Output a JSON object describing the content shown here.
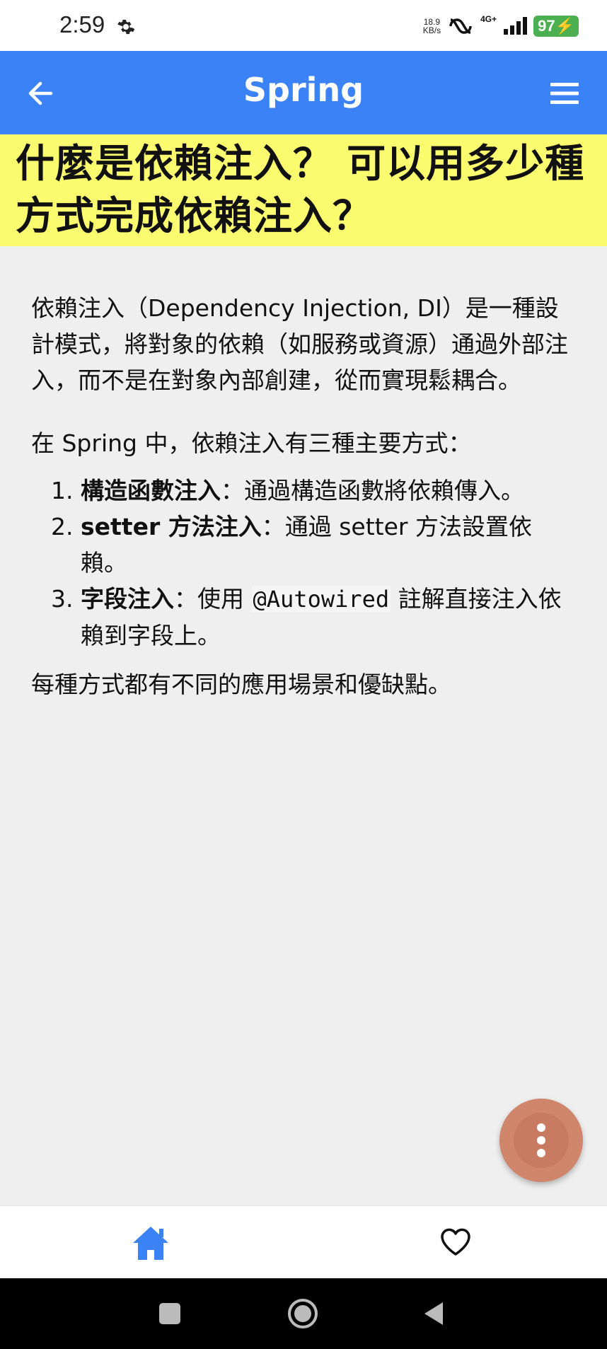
{
  "status_bar": {
    "time": "2:59",
    "net_speed_value": "18.9",
    "net_speed_unit": "KB/s",
    "network": "4G+",
    "battery": "97"
  },
  "app_bar": {
    "title": "Spring",
    "back_icon": "arrow-back-icon",
    "menu_icon": "hamburger-menu-icon",
    "color": "#3b82f6"
  },
  "question": {
    "title": "什麼是依賴注入？ 可以用多少種方式完成依賴注入？",
    "highlight_color": "#fbfb6f"
  },
  "answer": {
    "intro": "依賴注入（Dependency Injection, DI）是一種設計模式，將對象的依賴（如服務或資源）通過外部注入，而不是在對象內部創建，從而實現鬆耦合。",
    "lead": "在 Spring 中，依賴注入有三種主要方式：",
    "items": [
      {
        "term": "構造函數注入",
        "sep": "：",
        "desc": "通過構造函數將依賴傳入。"
      },
      {
        "term": "setter 方法注入",
        "sep": "：",
        "desc": "通過 setter 方法設置依賴。"
      },
      {
        "term": "字段注入",
        "sep": "：",
        "desc_before": "使用 ",
        "code": "@Autowired",
        "desc_after": " 註解直接注入依賴到字段上。"
      }
    ],
    "conclusion": "每種方式都有不同的應用場景和優缺點。"
  },
  "fab": {
    "icon": "more-vertical-icon",
    "color": "#cf866a"
  },
  "bottom_nav": {
    "home_icon": "home-icon",
    "favorite_icon": "heart-outline-icon",
    "active_color": "#3b82f6"
  },
  "system_nav": {
    "recents_icon": "square-icon",
    "home_icon": "circle-home-icon",
    "back_icon": "triangle-back-icon"
  }
}
